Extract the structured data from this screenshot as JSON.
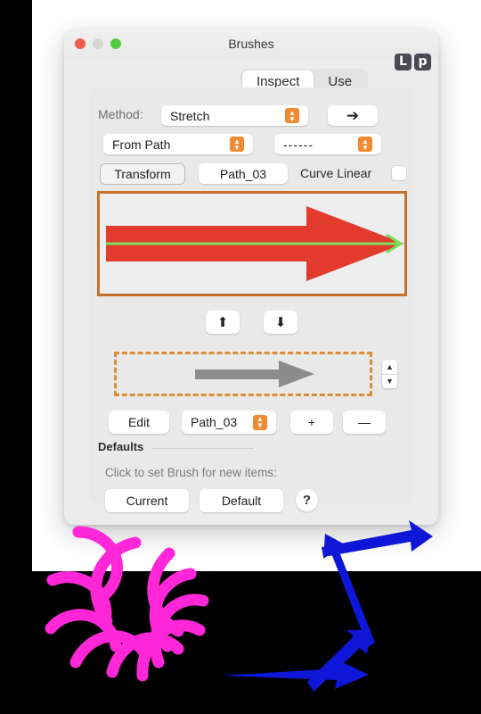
{
  "window": {
    "title": "Brushes",
    "traffic_lights": [
      "close-red",
      "minimize-gray",
      "zoom-green"
    ],
    "badges": [
      {
        "name": "badge-l",
        "label": "L"
      },
      {
        "name": "badge-p",
        "label": "p"
      }
    ]
  },
  "tabs": [
    {
      "label": "Inspect",
      "active": true
    },
    {
      "label": "Use",
      "active": false
    }
  ],
  "method_row": {
    "label": "Method:",
    "value": "Stretch",
    "apply_arrow": "➔"
  },
  "source_row": {
    "left_popup": "From Path",
    "right_popup": "------"
  },
  "transform_row": {
    "transform_button": "Transform",
    "path_field": "Path_03",
    "curve_linear_label": "Curve Linear",
    "curve_linear_checked": false
  },
  "preview": {
    "border_color": "#c8702a",
    "background": "#eeeeee",
    "arrow_fill": "#e23b2e",
    "path_stroke": "#77e05a"
  },
  "move_buttons": {
    "up": "⬆",
    "down": "⬇"
  },
  "brush_strip": {
    "border_color": "#dd8c3a",
    "arrow_fill": "#8c8c8c",
    "stepper_up": "▲",
    "stepper_down": "▼"
  },
  "edit_row": {
    "edit_button": "Edit",
    "path_popup": "Path_03",
    "add_button": "+",
    "remove_button": "—"
  },
  "defaults": {
    "title": "Defaults",
    "hint": "Click to set Brush for new items:",
    "current_button": "Current",
    "default_button": "Default",
    "help_button": "?"
  },
  "annotations": {
    "spiral_color": "#ff27d8",
    "arrow_color": "#0e17d8"
  }
}
